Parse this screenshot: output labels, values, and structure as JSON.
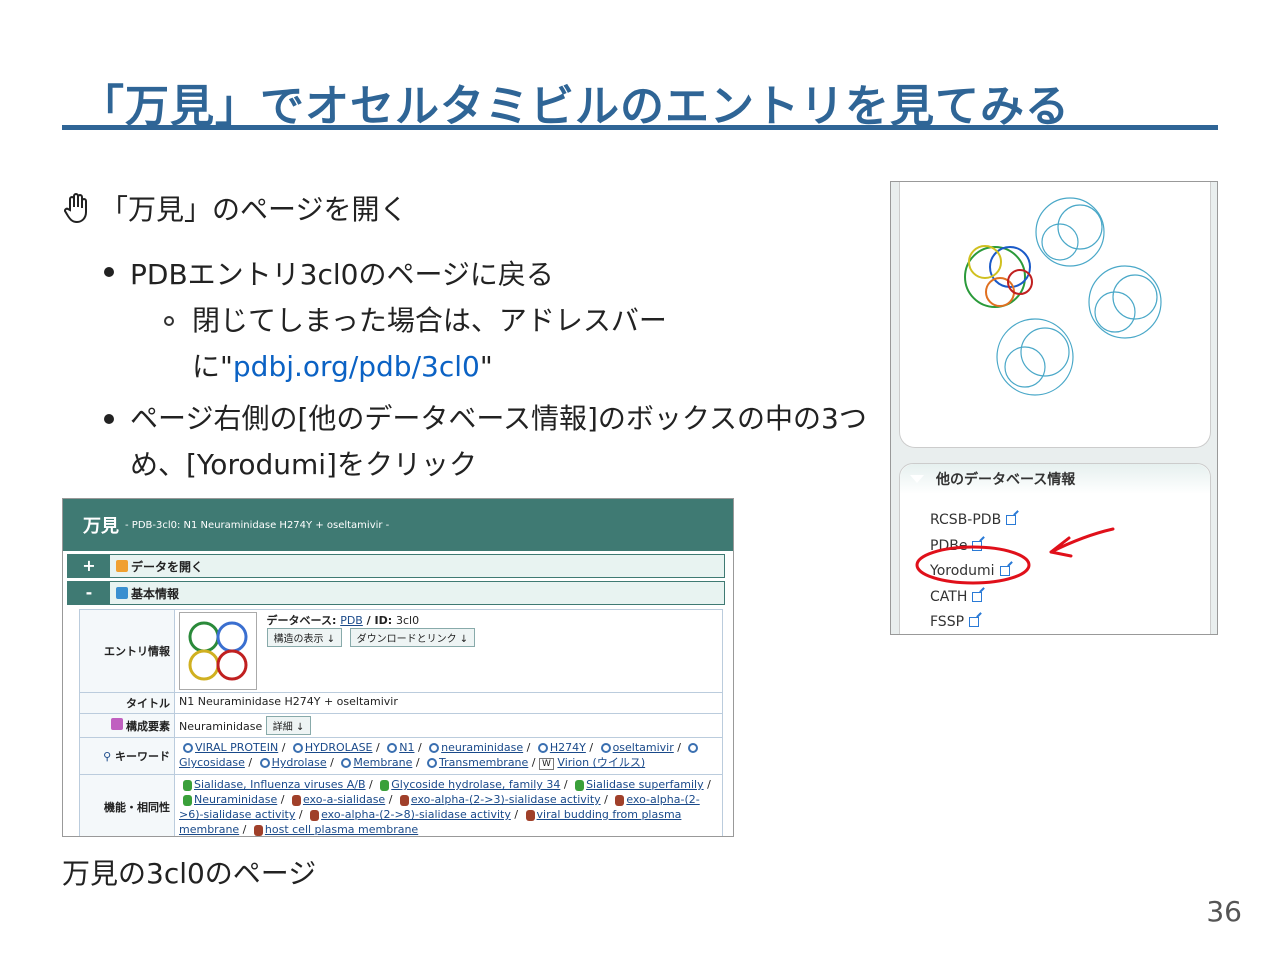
{
  "slide": {
    "title": "「万見」でオセルタミビルのエントリを見てみる",
    "step_text": "「万見」のページを開く",
    "bullet1": "PDBエントリ3cl0のページに戻る",
    "bullet1_sub_line1": "閉じてしまった場合は、アドレスバー",
    "bullet1_sub_prefix": "に\"",
    "bullet1_sub_link": "pdbj.org/pdb/3cl0",
    "bullet1_sub_suffix": "\"",
    "bullet2": "ページ右側の[他のデータベース情報]のボックスの中の3つめ、[Yorodumi]をクリック",
    "caption": "万見の3cl0のページ",
    "page_number": "36"
  },
  "shot1": {
    "logo": "万見",
    "subtitle": "- PDB-3cl0: N1 Neuraminidase H274Y + oseltamivir -",
    "sections": [
      {
        "toggle": "+",
        "label": "データを開く"
      },
      {
        "toggle": "-",
        "label": "基本情報"
      }
    ],
    "entry_label": "エントリ情報",
    "db_prefix": "データベース: ",
    "db_value": "PDB",
    "id_prefix": " / ID: ",
    "id_value": "3cl0",
    "btn_structure": "構造の表示",
    "btn_download": "ダウンロードとリンク",
    "title_label": "タイトル",
    "title_value": "N1 Neuraminidase H274Y + oseltamivir",
    "components_label": "構成要素",
    "components_value": "Neuraminidase",
    "components_btn": "詳細",
    "keyword_label": "キーワード",
    "keywords": [
      "VIRAL PROTEIN",
      "HYDROLASE",
      "N1",
      "neuraminidase",
      "H274Y",
      "oseltamivir",
      "Glycosidase",
      "Hydrolase",
      "Membrane",
      "Transmembrane",
      "Virion (ウイルス)"
    ],
    "function_label": "機能・相同性",
    "functions": [
      "Sialidase, Influenza viruses A/B",
      "Glycoside hydrolase, family 34",
      "Sialidase superfamily",
      "Neuraminidase",
      "exo-a-sialidase",
      "exo-alpha-(2->3)-sialidase activity",
      "exo-alpha-(2->6)-sialidase activity",
      "exo-alpha-(2->8)-sialidase activity",
      "viral budding from plasma membrane",
      "host cell plasma membrane"
    ]
  },
  "shot2": {
    "panel_title": "他のデータベース情報",
    "links": [
      "RCSB-PDB",
      "PDBe",
      "Yorodumi",
      "CATH",
      "FSSP"
    ]
  },
  "colors": {
    "title_blue": "#2f6596",
    "link_blue": "#0b62c4",
    "header_teal": "#3f7a73",
    "annotation_red": "#e0101a"
  }
}
